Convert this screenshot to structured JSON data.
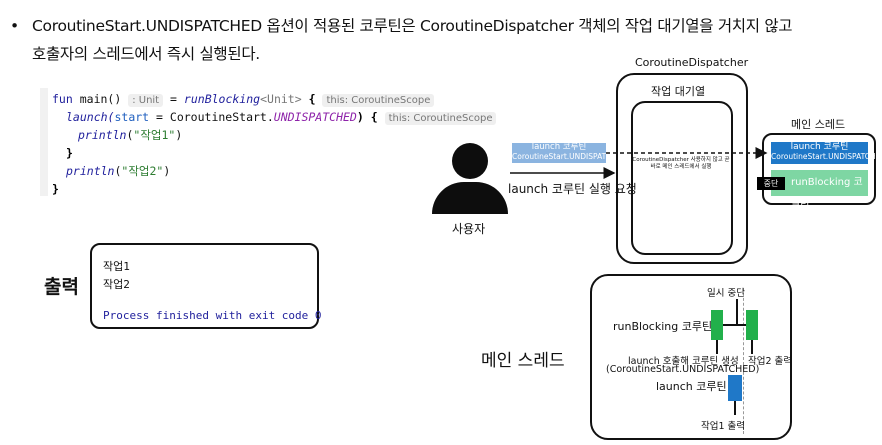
{
  "header": {
    "bullet": "•",
    "line1": "CoroutineStart.UNDISPATCHED 옵션이 적용된 코루틴은 CoroutineDispatcher 객체의 작업 대기열을 거치지 않고",
    "line2": "호출자의 스레드에서 즉시 실행된다."
  },
  "code": {
    "fun": "fun",
    "main": "main()",
    "hint_unit": ": Unit",
    "eq": "=",
    "runBlocking": "runBlocking",
    "unit_generic": "<Unit>",
    "lbrace": "{",
    "hint_scope1": "this: CoroutineScope",
    "launch": "launch(",
    "start_param": "start",
    "eq2": "=",
    "coroutine_start": "CoroutineStart.",
    "undispatched": "UNDISPATCHED",
    "close_paren_brace": ") {",
    "hint_scope2": "this: CoroutineScope",
    "println": "println",
    "arg1_open": "(",
    "arg1": "\"작업1\"",
    "arg1_close": ")",
    "close1": "}",
    "arg2": "\"작업2\"",
    "close2": "}"
  },
  "output": {
    "label": "출력",
    "lines": [
      "작업1",
      "작업2"
    ],
    "finished": "Process finished with exit code 0"
  },
  "diagram": {
    "user_label": "사용자",
    "launch_tag_title": "launch 코루틴",
    "launch_tag_sub": "CoroutineStart.UNDISPATCHED",
    "request_label": "launch 코루틴 실행 요청",
    "dispatcher_title": "CoroutineDispatcher",
    "queue_label": "작업 대기열",
    "dispatcher_note": "CoroutineDispatcher 사용하지 않고 곧바로 메인 스레드에서 실행",
    "main_thread_title": "메인 스레드",
    "mt_launch_title": "launch 코루틴",
    "mt_launch_sub": "CoroutineStart.UNDISPATCHED",
    "mt_runblocking": "runBlocking 코루틴",
    "pause_tag": "중단"
  },
  "timeline": {
    "title": "메인 스레드",
    "pause_label": "일시 중단",
    "runblocking_label": "runBlocking 코루틴",
    "create_label_1": "launch 호출해 코루틴 생성",
    "create_label_2": "(CoroutineStart.UNDISPATCHED)",
    "job2_label": "작업2 출력",
    "launch_label": "launch 코루틴",
    "job1_label": "작업1 출력"
  },
  "colors": {
    "launch_blue": "#1f78c8",
    "launch_light": "#8bb4e0",
    "runblocking_green": "#22b04b",
    "runblocking_light": "#7ed6a3"
  }
}
